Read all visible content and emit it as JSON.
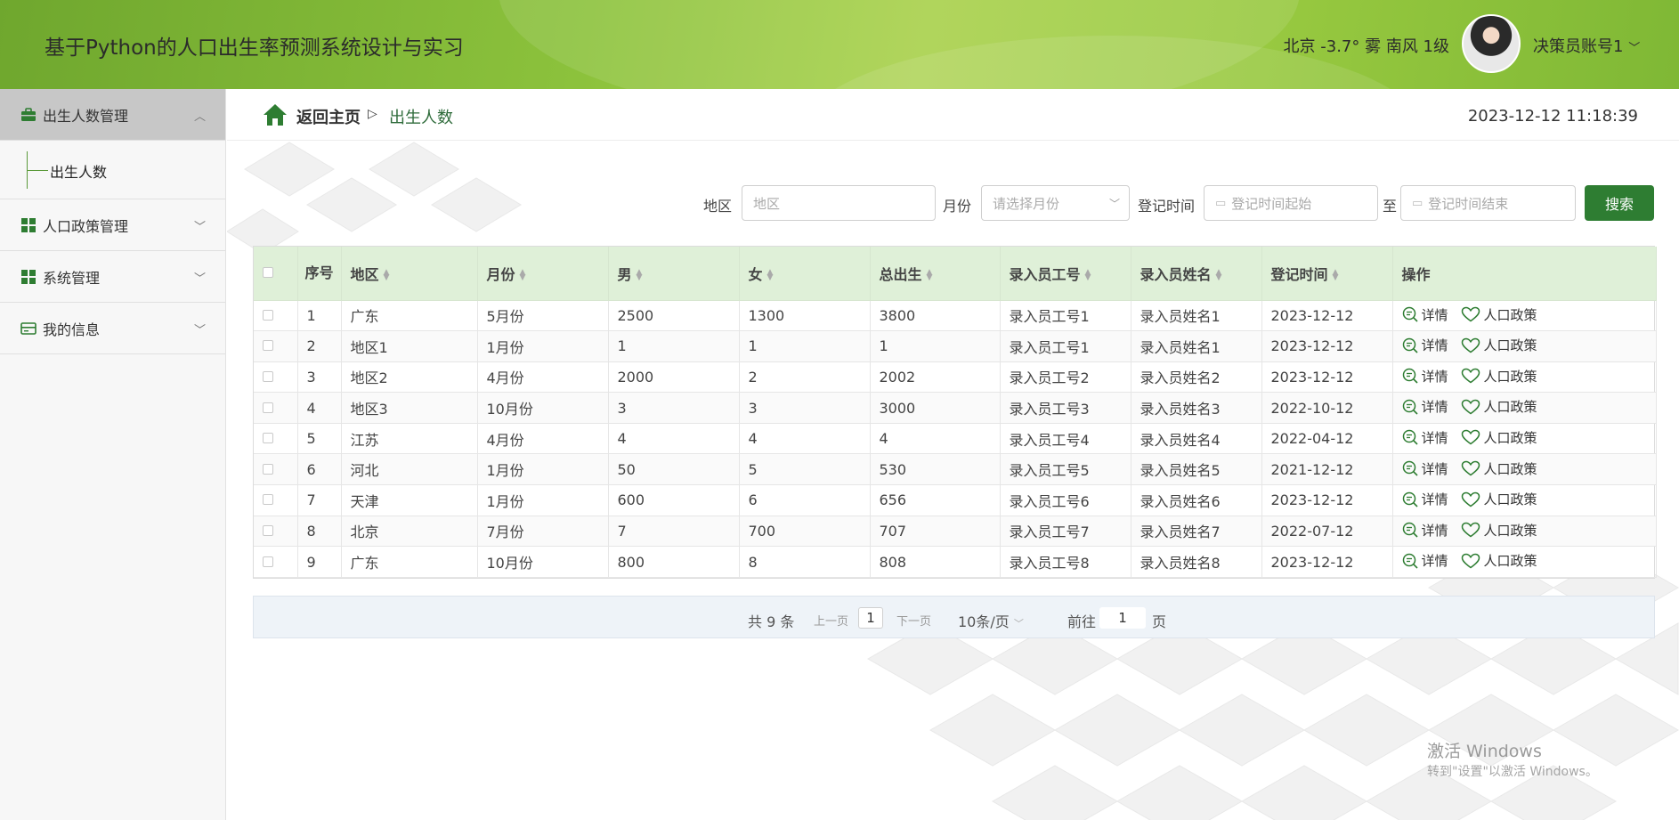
{
  "header": {
    "title": "基于Python的人口出生率预测系统设计与实习",
    "weather": "北京 -3.7° 雾 南风 1级",
    "account": "决策员账号1"
  },
  "sidebar": {
    "items": [
      {
        "label": "出生人数管理",
        "icon": "briefcase-icon",
        "chevron": "︿",
        "sub": "出生人数"
      },
      {
        "label": "人口政策管理",
        "icon": "grid-icon",
        "chevron": "﹀"
      },
      {
        "label": "系统管理",
        "icon": "grid-icon",
        "chevron": "﹀"
      },
      {
        "label": "我的信息",
        "icon": "card-icon",
        "chevron": "﹀"
      }
    ]
  },
  "breadcrumb": {
    "home": "返回主页",
    "sep": "▷",
    "current": "出生人数"
  },
  "clock": "2023-12-12 11:18:39",
  "search": {
    "region_label": "地区",
    "region_placeholder": "地区",
    "month_label": "月份",
    "month_placeholder": "请选择月份",
    "time_label": "登记时间",
    "time_start": "登记时间起始",
    "to": "至",
    "time_end": "登记时间结束",
    "button": "搜索"
  },
  "table": {
    "headers": [
      "序号",
      "地区",
      "月份",
      "男",
      "女",
      "总出生",
      "录入员工号",
      "录入员姓名",
      "登记时间",
      "操作"
    ],
    "rows": [
      [
        "1",
        "广东",
        "5月份",
        "2500",
        "1300",
        "3800",
        "录入员工号1",
        "录入员姓名1",
        "2023-12-12"
      ],
      [
        "2",
        "地区1",
        "1月份",
        "1",
        "1",
        "1",
        "录入员工号1",
        "录入员姓名1",
        "2023-12-12"
      ],
      [
        "3",
        "地区2",
        "4月份",
        "2000",
        "2",
        "2002",
        "录入员工号2",
        "录入员姓名2",
        "2023-12-12"
      ],
      [
        "4",
        "地区3",
        "10月份",
        "3",
        "3",
        "3000",
        "录入员工号3",
        "录入员姓名3",
        "2022-10-12"
      ],
      [
        "5",
        "江苏",
        "4月份",
        "4",
        "4",
        "4",
        "录入员工号4",
        "录入员姓名4",
        "2022-04-12"
      ],
      [
        "6",
        "河北",
        "1月份",
        "50",
        "5",
        "530",
        "录入员工号5",
        "录入员姓名5",
        "2021-12-12"
      ],
      [
        "7",
        "天津",
        "1月份",
        "600",
        "6",
        "656",
        "录入员工号6",
        "录入员姓名6",
        "2023-12-12"
      ],
      [
        "8",
        "北京",
        "7月份",
        "7",
        "700",
        "707",
        "录入员工号7",
        "录入员姓名7",
        "2022-07-12"
      ],
      [
        "9",
        "广东",
        "10月份",
        "800",
        "8",
        "808",
        "录入员工号8",
        "录入员姓名8",
        "2023-12-12"
      ]
    ],
    "actions": {
      "detail": "详情",
      "policy": "人口政策"
    }
  },
  "pager": {
    "total": "共 9 条",
    "prev": "上一页",
    "page": "1",
    "next": "下一页",
    "size": "10条/页",
    "goto": "前往",
    "goto_value": "1",
    "page_unit": "页"
  },
  "watermark": {
    "line1": "激活 Windows",
    "line2": "转到\"设置\"以激活 Windows。"
  },
  "colors": {
    "accent": "#2e7d32",
    "header": "#8cc23c",
    "table_head": "#dff0d8"
  }
}
